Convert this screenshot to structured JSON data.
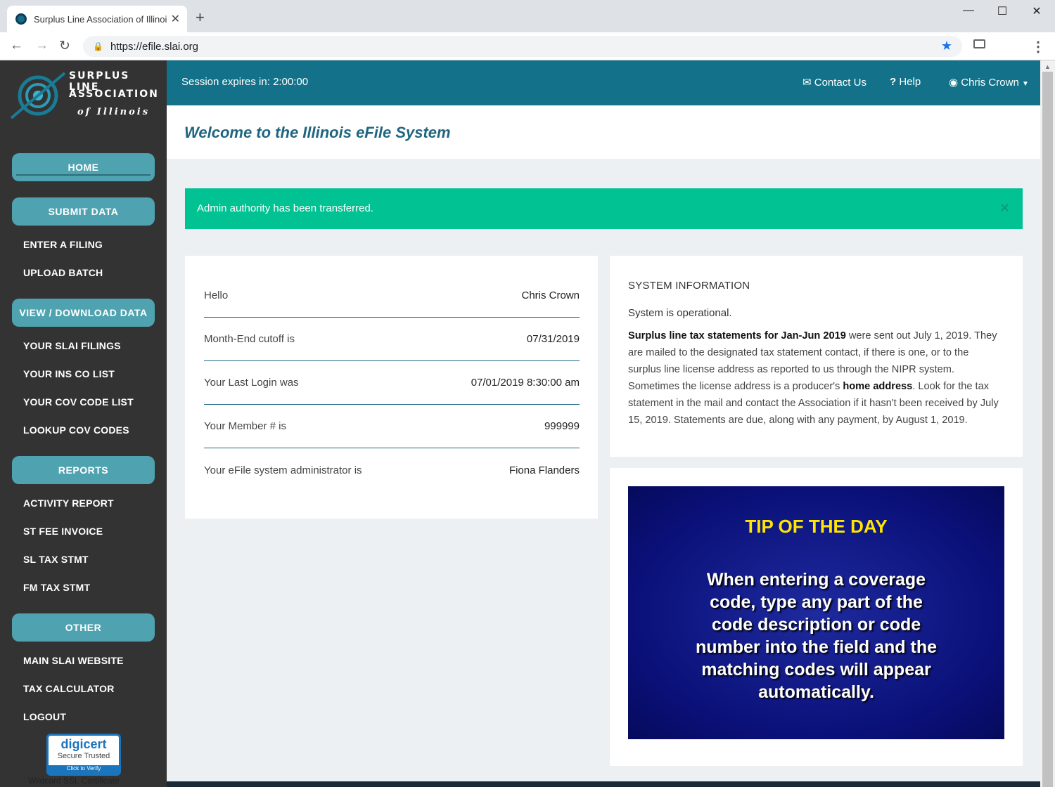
{
  "browser": {
    "tab_title": "Surplus Line Association of Illinois",
    "url": "https://efile.slai.org"
  },
  "logo": {
    "line1": "SURPLUS LINE",
    "line2": "ASSOCIATION",
    "line3": "of Illinois"
  },
  "sidebar": {
    "home": "HOME",
    "submit_data": "SUBMIT DATA",
    "enter_filing": "ENTER A FILING",
    "upload_batch": "UPLOAD BATCH",
    "view_download": "VIEW / DOWNLOAD DATA",
    "your_filings": "YOUR SLAI FILINGS",
    "ins_co_list": "YOUR INS CO LIST",
    "cov_code_list": "YOUR COV CODE LIST",
    "lookup_cov": "LOOKUP COV CODES",
    "reports": "REPORTS",
    "activity_report": "ACTIVITY REPORT",
    "st_fee_invoice": "ST FEE INVOICE",
    "sl_tax_stmt": "SL TAX STMT",
    "fm_tax_stmt": "FM TAX STMT",
    "other": "OTHER",
    "main_website": "MAIN SLAI WEBSITE",
    "tax_calculator": "TAX CALCULATOR",
    "logout": "LOGOUT"
  },
  "badge": {
    "brand": "digicert",
    "line2": "Secure Trusted",
    "line3": "Click to Verify",
    "caption": "Wildcard SSL Certificate"
  },
  "topbar": {
    "session": "Session expires in: 2:00:00",
    "contact": "Contact Us",
    "help": "Help",
    "user": "Chris Crown"
  },
  "header": {
    "title": "Welcome to the Illinois eFile System"
  },
  "alert": {
    "message": "Admin authority has been transferred."
  },
  "info": {
    "hello_label": "Hello",
    "hello_value": "Chris Crown",
    "cutoff_label": "Month-End cutoff is",
    "cutoff_value": "07/31/2019",
    "login_label": "Your Last Login was",
    "login_value": "07/01/2019 8:30:00 am",
    "member_label": "Your Member # is",
    "member_value": "999999",
    "admin_label": "Your eFile system administrator is",
    "admin_value": "Fiona Flanders"
  },
  "system": {
    "title": "SYSTEM INFORMATION",
    "status": "System is operational.",
    "bold1": "Surplus line tax statements for Jan-Jun 2019",
    "text1": " were sent out July 1, 2019. They are mailed to the designated tax statement contact, if there is one, or to the surplus line license address as reported to us through the NIPR system. Sometimes the license address is a producer's ",
    "bold2": "home address",
    "text2": ". Look for the tax statement in the mail and contact the Association if it hasn't been received by July 15, 2019. Statements are due, along with any payment, by August 1, 2019."
  },
  "tip": {
    "title": "TIP OF THE DAY",
    "text": "When entering a coverage code, type any part of the code description or code number into the field and the matching codes will appear automatically."
  }
}
